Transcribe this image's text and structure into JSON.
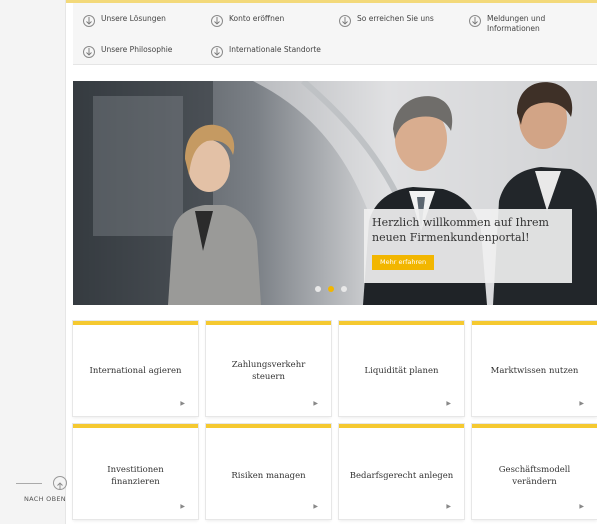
{
  "nav": {
    "items": [
      {
        "label": "Unsere Lösungen",
        "icon": "arrow-down-circle-icon"
      },
      {
        "label": "Konto eröffnen",
        "icon": "arrow-down-circle-icon"
      },
      {
        "label": "So erreichen Sie uns",
        "icon": "arrow-down-circle-icon"
      },
      {
        "label": "Meldungen und Informationen",
        "icon": "arrow-down-circle-icon"
      },
      {
        "label": "Unsere Philosophie",
        "icon": "arrow-down-circle-icon"
      },
      {
        "label": "Internationale Standorte",
        "icon": "arrow-down-circle-icon"
      }
    ]
  },
  "hero": {
    "title": "Herzlich willkommen auf Ihrem neuen Firmenkundenportal!",
    "button_label": "Mehr erfahren",
    "slide_count": 3,
    "active_slide": 2
  },
  "tiles": [
    {
      "label": "International agieren"
    },
    {
      "label": "Zahlungsverkehr steuern"
    },
    {
      "label": "Liquidität planen"
    },
    {
      "label": "Marktwissen nutzen"
    },
    {
      "label": "Investitionen finanzieren"
    },
    {
      "label": "Risiken managen"
    },
    {
      "label": "Bedarfsgerecht anlegen"
    },
    {
      "label": "Geschäftsmodell verändern"
    }
  ],
  "back_to_top": {
    "label": "NACH OBEN",
    "icon": "arrow-up-circle-icon"
  },
  "colors": {
    "accent": "#f2b600",
    "tile_border": "#f5c930",
    "rail": "#f4f4f4"
  }
}
